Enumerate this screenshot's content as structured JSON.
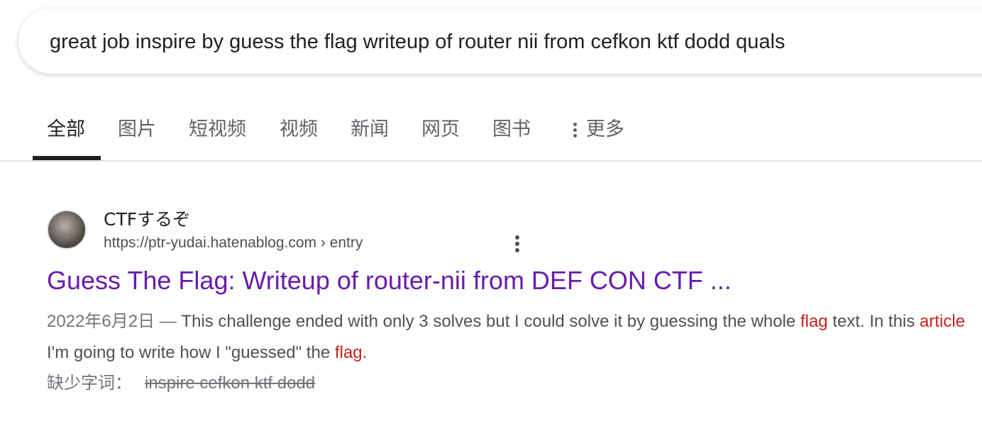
{
  "search": {
    "query": "great job inspire by guess the flag writeup of router nii from cefkon ktf dodd quals"
  },
  "tabs": [
    {
      "label": "全部",
      "active": true
    },
    {
      "label": "图片"
    },
    {
      "label": "短视频"
    },
    {
      "label": "视频"
    },
    {
      "label": "新闻"
    },
    {
      "label": "网页"
    },
    {
      "label": "图书"
    },
    {
      "label": "更多"
    }
  ],
  "result": {
    "site_name": "CTFするぞ",
    "url": "https://ptr-yudai.hatenablog.com › entry",
    "title": "Guess The Flag: Writeup of router-nii from DEF CON CTF ...",
    "snippet": {
      "date": "2022年6月2日 — ",
      "part1": "This challenge ended with only 3 solves but I could solve it by guessing the whole ",
      "hl1": "flag",
      "part2": " text. In this ",
      "hl2": "article",
      "part3": " I'm going to write how I \"guessed\" the ",
      "hl3": "flag",
      "part4": "."
    },
    "missing_label": "缺少字词：",
    "missing_terms": "inspire cefkon ktf dodd"
  },
  "colors": {
    "link_visited": "#681da8",
    "highlight": "#c5221f",
    "text_secondary": "#4d5156"
  }
}
